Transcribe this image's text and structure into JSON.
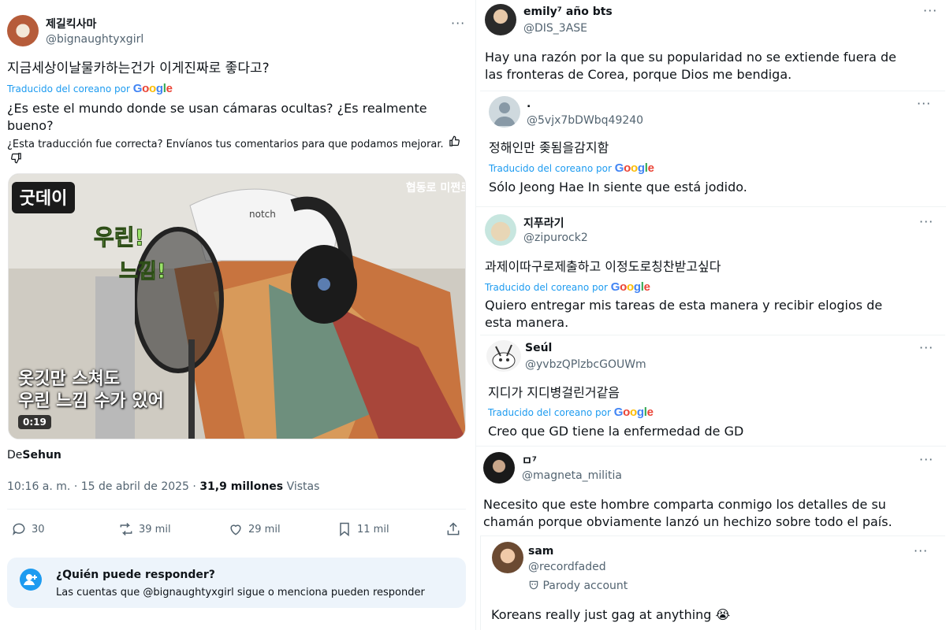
{
  "translate": {
    "label": "Traducido del coreano por",
    "logo": [
      "G",
      "o",
      "o",
      "g",
      "l",
      "e"
    ]
  },
  "main_tweet": {
    "display_name": "제길킥사마",
    "handle": "@bignaughtyxgirl",
    "original_text": "지금세상이날물카하는건가 이게진짜로 좋다고?",
    "translated_text": "¿Es este el mundo donde se usan cámaras ocultas? ¿Es realmente bueno?",
    "feedback": "¿Esta traducción fue correcta? Envíanos tus comentarios para que podamos mejorar.",
    "video": {
      "subtitle_line1": "옷깃만 스쳐도",
      "subtitle_line2": "우린 느낌 수가 있어",
      "bubble1": "우린!",
      "bubble2": "느낌!",
      "logo_text": "굿데이",
      "corner_text": "협동로 미쩐로",
      "cap_text": "notch",
      "duration": "0:19"
    },
    "from_prefix": "De",
    "from_name": "Sehun",
    "timestamp": "10:16 a. m. · 15 de abril de 2025 · ",
    "views_count": "31,9 millones",
    "views_label": " Vistas",
    "actions": {
      "replies": "30",
      "retweets": "39 mil",
      "likes": "29 mil",
      "bookmarks": "11 mil"
    },
    "who_can_reply": {
      "title": "¿Quién puede responder?",
      "subtitle": "Las cuentas que @bignaughtyxgirl sigue o menciona pueden responder"
    }
  },
  "replies": [
    {
      "display_name": "emily⁷ año bts",
      "handle": "@DIS_3ASE",
      "text": "Hay una razón por la que su popularidad no se extiende fuera de las fronteras de Corea, porque Dios me bendiga."
    },
    {
      "display_name": ".",
      "handle": "@5vjx7bDWbq49240",
      "original_text": "정해인만 좆됨을감지함",
      "translated_text": "Sólo Jeong Hae In siente que está jodido."
    },
    {
      "display_name": "지푸라기",
      "handle": "@zipurock2",
      "original_text": "과제이따구로제출하고 이정도로칭찬받고싶다",
      "translated_text": "Quiero entregar mis tareas de esta manera y recibir elogios de esta manera."
    },
    {
      "display_name": "Seúl",
      "handle": "@yvbzQPlzbcGOUWm",
      "original_text": "지디가 지디병걸린거같음",
      "translated_text": "Creo que GD tiene la enfermedad de GD"
    },
    {
      "display_name": "ㅁ⁷",
      "handle": "@magneta_militia",
      "text": "Necesito que este hombre comparta conmigo los detalles de su chamán porque obviamente lanzó un hechizo sobre todo el país."
    },
    {
      "display_name": "sam",
      "handle": "@recordfaded",
      "badge": "Parody account",
      "text": "Koreans really just gag at anything 😭"
    }
  ],
  "more_label": "···"
}
